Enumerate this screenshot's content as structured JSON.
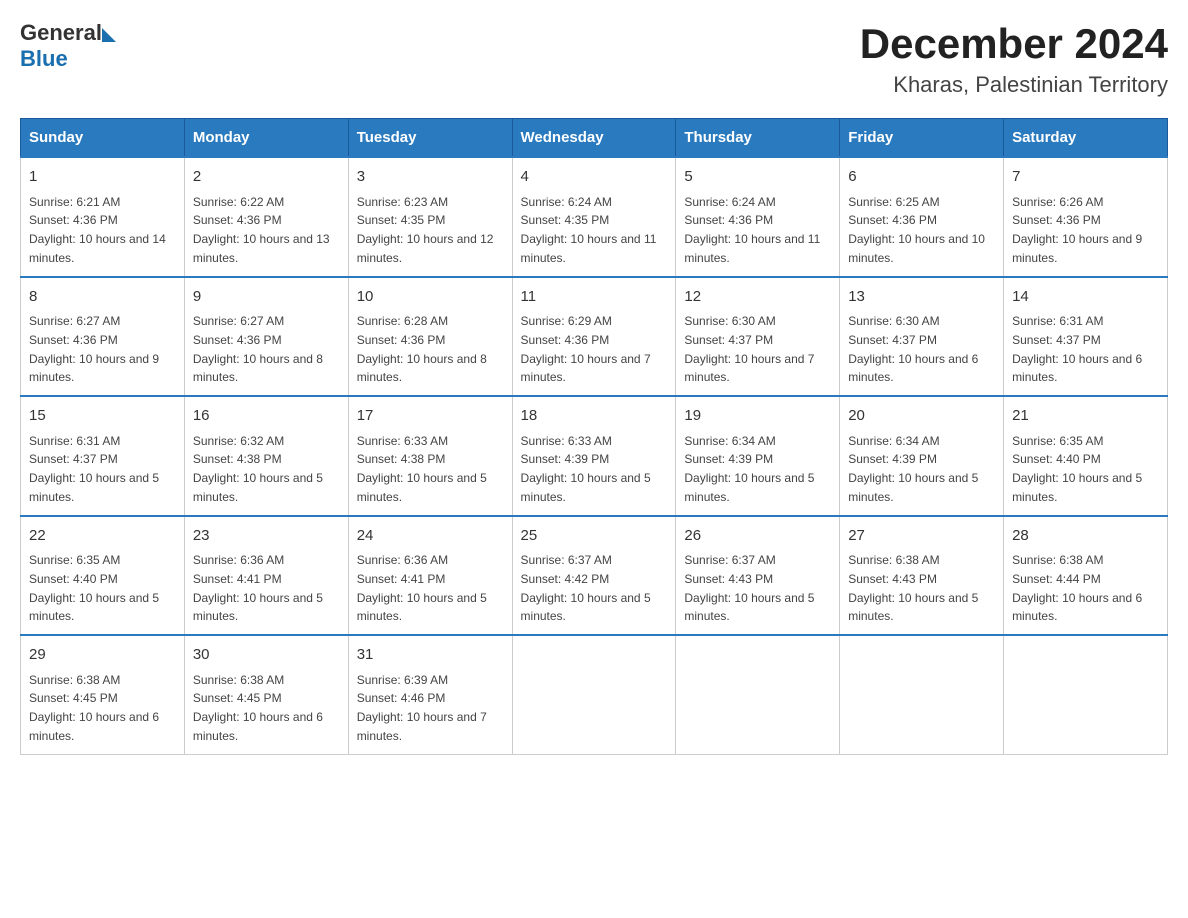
{
  "header": {
    "logo": {
      "general": "General",
      "blue": "Blue"
    },
    "title": "December 2024",
    "subtitle": "Kharas, Palestinian Territory"
  },
  "calendar": {
    "weekdays": [
      "Sunday",
      "Monday",
      "Tuesday",
      "Wednesday",
      "Thursday",
      "Friday",
      "Saturday"
    ],
    "weeks": [
      [
        {
          "day": "1",
          "sunrise": "6:21 AM",
          "sunset": "4:36 PM",
          "daylight": "10 hours and 14 minutes."
        },
        {
          "day": "2",
          "sunrise": "6:22 AM",
          "sunset": "4:36 PM",
          "daylight": "10 hours and 13 minutes."
        },
        {
          "day": "3",
          "sunrise": "6:23 AM",
          "sunset": "4:35 PM",
          "daylight": "10 hours and 12 minutes."
        },
        {
          "day": "4",
          "sunrise": "6:24 AM",
          "sunset": "4:35 PM",
          "daylight": "10 hours and 11 minutes."
        },
        {
          "day": "5",
          "sunrise": "6:24 AM",
          "sunset": "4:36 PM",
          "daylight": "10 hours and 11 minutes."
        },
        {
          "day": "6",
          "sunrise": "6:25 AM",
          "sunset": "4:36 PM",
          "daylight": "10 hours and 10 minutes."
        },
        {
          "day": "7",
          "sunrise": "6:26 AM",
          "sunset": "4:36 PM",
          "daylight": "10 hours and 9 minutes."
        }
      ],
      [
        {
          "day": "8",
          "sunrise": "6:27 AM",
          "sunset": "4:36 PM",
          "daylight": "10 hours and 9 minutes."
        },
        {
          "day": "9",
          "sunrise": "6:27 AM",
          "sunset": "4:36 PM",
          "daylight": "10 hours and 8 minutes."
        },
        {
          "day": "10",
          "sunrise": "6:28 AM",
          "sunset": "4:36 PM",
          "daylight": "10 hours and 8 minutes."
        },
        {
          "day": "11",
          "sunrise": "6:29 AM",
          "sunset": "4:36 PM",
          "daylight": "10 hours and 7 minutes."
        },
        {
          "day": "12",
          "sunrise": "6:30 AM",
          "sunset": "4:37 PM",
          "daylight": "10 hours and 7 minutes."
        },
        {
          "day": "13",
          "sunrise": "6:30 AM",
          "sunset": "4:37 PM",
          "daylight": "10 hours and 6 minutes."
        },
        {
          "day": "14",
          "sunrise": "6:31 AM",
          "sunset": "4:37 PM",
          "daylight": "10 hours and 6 minutes."
        }
      ],
      [
        {
          "day": "15",
          "sunrise": "6:31 AM",
          "sunset": "4:37 PM",
          "daylight": "10 hours and 5 minutes."
        },
        {
          "day": "16",
          "sunrise": "6:32 AM",
          "sunset": "4:38 PM",
          "daylight": "10 hours and 5 minutes."
        },
        {
          "day": "17",
          "sunrise": "6:33 AM",
          "sunset": "4:38 PM",
          "daylight": "10 hours and 5 minutes."
        },
        {
          "day": "18",
          "sunrise": "6:33 AM",
          "sunset": "4:39 PM",
          "daylight": "10 hours and 5 minutes."
        },
        {
          "day": "19",
          "sunrise": "6:34 AM",
          "sunset": "4:39 PM",
          "daylight": "10 hours and 5 minutes."
        },
        {
          "day": "20",
          "sunrise": "6:34 AM",
          "sunset": "4:39 PM",
          "daylight": "10 hours and 5 minutes."
        },
        {
          "day": "21",
          "sunrise": "6:35 AM",
          "sunset": "4:40 PM",
          "daylight": "10 hours and 5 minutes."
        }
      ],
      [
        {
          "day": "22",
          "sunrise": "6:35 AM",
          "sunset": "4:40 PM",
          "daylight": "10 hours and 5 minutes."
        },
        {
          "day": "23",
          "sunrise": "6:36 AM",
          "sunset": "4:41 PM",
          "daylight": "10 hours and 5 minutes."
        },
        {
          "day": "24",
          "sunrise": "6:36 AM",
          "sunset": "4:41 PM",
          "daylight": "10 hours and 5 minutes."
        },
        {
          "day": "25",
          "sunrise": "6:37 AM",
          "sunset": "4:42 PM",
          "daylight": "10 hours and 5 minutes."
        },
        {
          "day": "26",
          "sunrise": "6:37 AM",
          "sunset": "4:43 PM",
          "daylight": "10 hours and 5 minutes."
        },
        {
          "day": "27",
          "sunrise": "6:38 AM",
          "sunset": "4:43 PM",
          "daylight": "10 hours and 5 minutes."
        },
        {
          "day": "28",
          "sunrise": "6:38 AM",
          "sunset": "4:44 PM",
          "daylight": "10 hours and 6 minutes."
        }
      ],
      [
        {
          "day": "29",
          "sunrise": "6:38 AM",
          "sunset": "4:45 PM",
          "daylight": "10 hours and 6 minutes."
        },
        {
          "day": "30",
          "sunrise": "6:38 AM",
          "sunset": "4:45 PM",
          "daylight": "10 hours and 6 minutes."
        },
        {
          "day": "31",
          "sunrise": "6:39 AM",
          "sunset": "4:46 PM",
          "daylight": "10 hours and 7 minutes."
        },
        null,
        null,
        null,
        null
      ]
    ]
  }
}
